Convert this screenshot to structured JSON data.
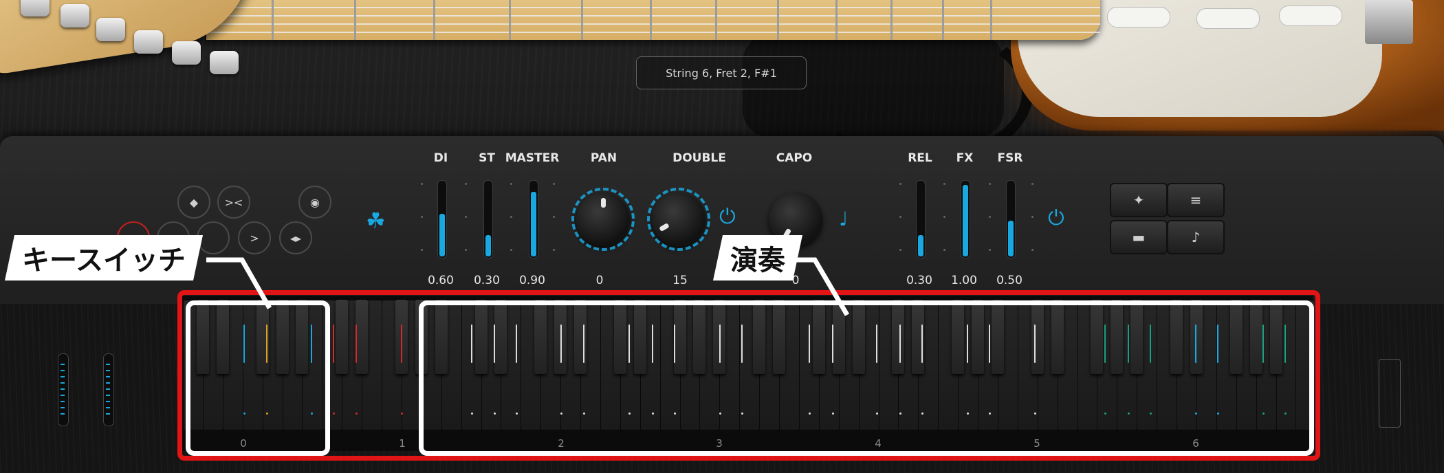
{
  "status_bar": {
    "text": "String 6, Fret 2, F#1"
  },
  "controls": {
    "di": {
      "label": "DI",
      "value": "0.60",
      "level": 0.6
    },
    "st": {
      "label": "ST",
      "value": "0.30",
      "level": 0.3
    },
    "master": {
      "label": "MASTER",
      "value": "0.90",
      "level": 0.9
    },
    "pan": {
      "label": "PAN",
      "value": "0"
    },
    "double": {
      "label": "DOUBLE",
      "value": "15"
    },
    "capo": {
      "label": "CAPO",
      "value": "0"
    },
    "rel": {
      "label": "REL",
      "value": "0.30",
      "level": 0.3
    },
    "fx": {
      "label": "FX",
      "value": "1.00",
      "level": 1.0
    },
    "fsr": {
      "label": "FSR",
      "value": "0.50",
      "level": 0.5
    }
  },
  "keyboard": {
    "octave_labels": [
      "0",
      "1",
      "2",
      "3",
      "4",
      "5",
      "6"
    ]
  },
  "annotations": {
    "keyswitch_label": "キースイッチ",
    "play_label": "演奏"
  },
  "colors": {
    "accent": "#1aa8e0",
    "highlight_red": "#e11515",
    "keyswitch_orange": "#e0a020",
    "keyswitch_red": "#d42a2a",
    "green": "#1aa080"
  },
  "icons": {
    "transport": [
      "diamond-icon",
      "crossfade-icon",
      "record-icon",
      "play-icon",
      "left-right-arrow-icon",
      "circle-dot-icon"
    ],
    "brand": "trefoil-logo-icon",
    "power": "power-icon",
    "notes": "strum-note-icon",
    "articulation": [
      "guitar-strum-icon",
      "comb-mute-icon",
      "slide-icon",
      "harmonic-icon"
    ]
  }
}
